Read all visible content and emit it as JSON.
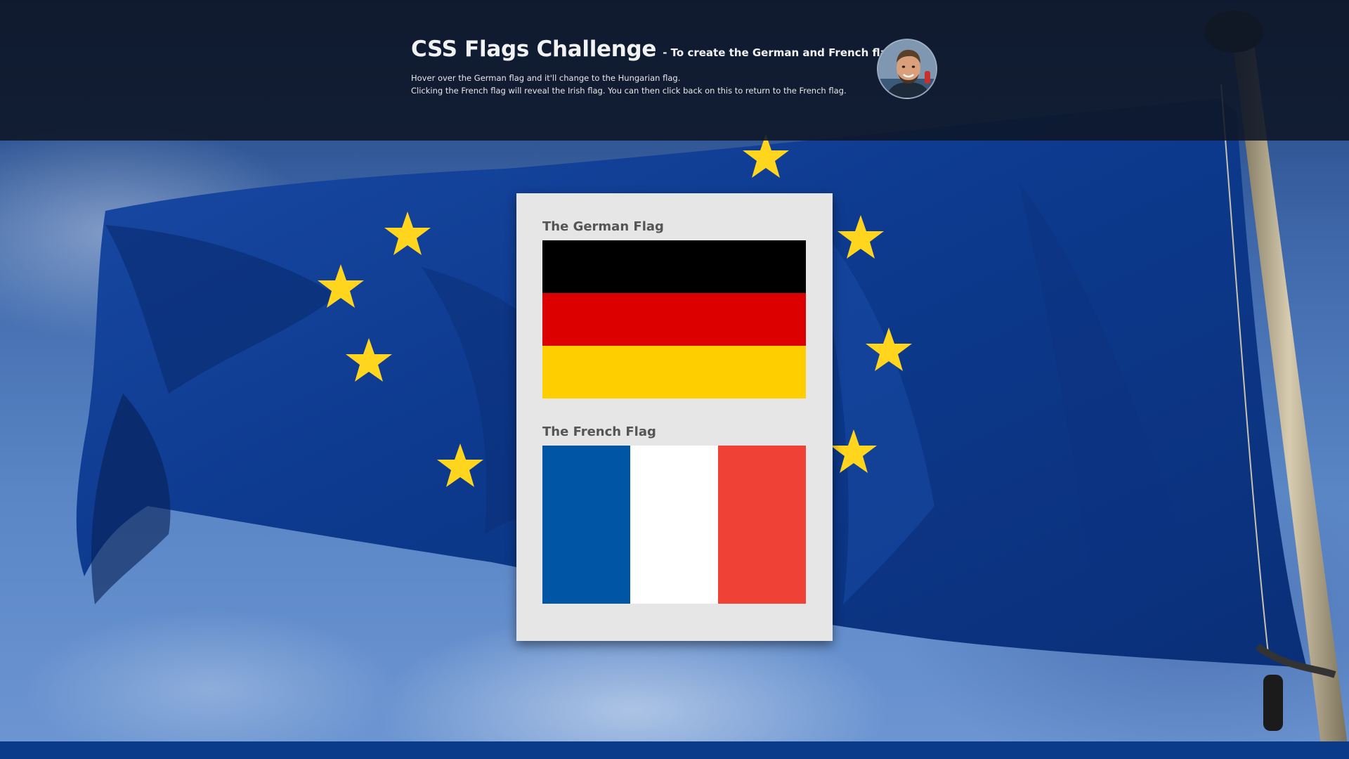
{
  "header": {
    "title": "CSS Flags Challenge",
    "subtitle": "- To create the German and French flags.",
    "instruction_1": "Hover over the German flag and it'll change to the Hungarian flag.",
    "instruction_2": "Clicking the French flag will reveal the Irish flag. You can then click back on this to return to the French flag."
  },
  "avatar": {
    "icon": "person-photo-icon"
  },
  "german": {
    "title": "The German Flag",
    "colors": [
      "#000000",
      "#dd0000",
      "#ffce00"
    ]
  },
  "french": {
    "title": "The French Flag",
    "colors": [
      "#0055a4",
      "#ffffff",
      "#ef4135"
    ]
  },
  "background": {
    "flag_blue": "#0f3a8c",
    "star_color": "#ffd700"
  },
  "footer": {
    "color": "#0a3a8a"
  }
}
